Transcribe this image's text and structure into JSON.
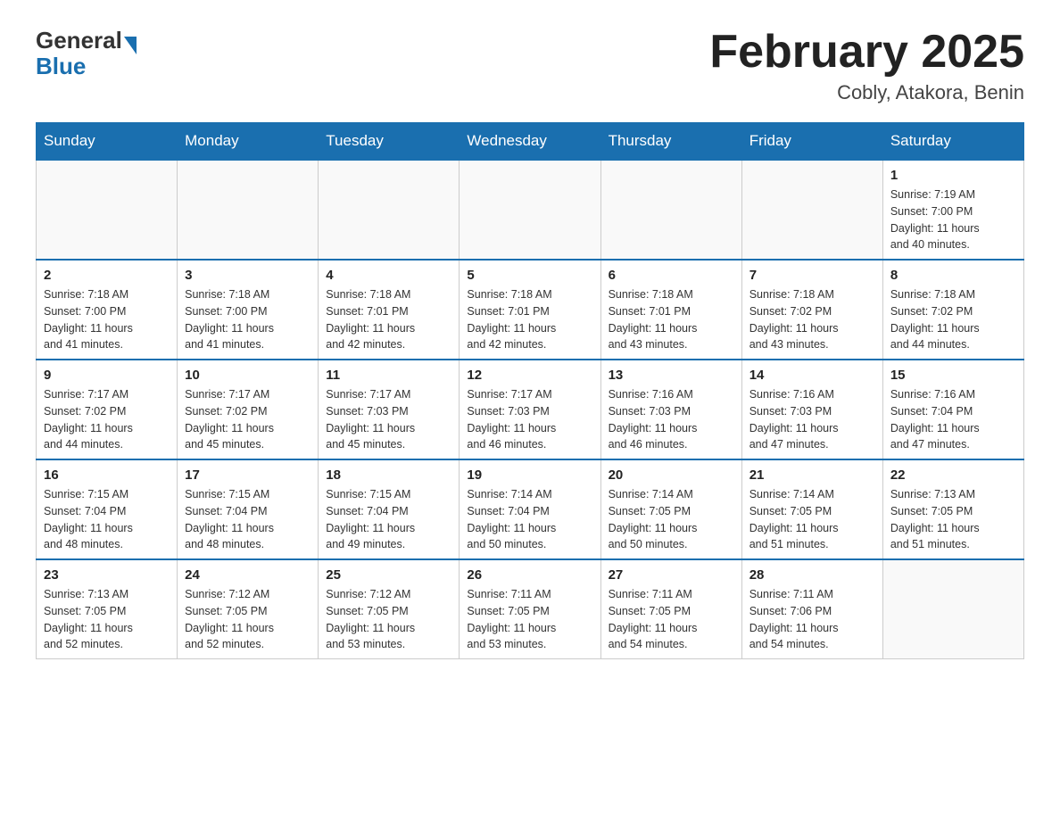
{
  "header": {
    "logo": {
      "general": "General",
      "blue": "Blue"
    },
    "title": "February 2025",
    "location": "Cobly, Atakora, Benin"
  },
  "days_of_week": [
    "Sunday",
    "Monday",
    "Tuesday",
    "Wednesday",
    "Thursday",
    "Friday",
    "Saturday"
  ],
  "weeks": [
    [
      {
        "day": "",
        "info": ""
      },
      {
        "day": "",
        "info": ""
      },
      {
        "day": "",
        "info": ""
      },
      {
        "day": "",
        "info": ""
      },
      {
        "day": "",
        "info": ""
      },
      {
        "day": "",
        "info": ""
      },
      {
        "day": "1",
        "info": "Sunrise: 7:19 AM\nSunset: 7:00 PM\nDaylight: 11 hours\nand 40 minutes."
      }
    ],
    [
      {
        "day": "2",
        "info": "Sunrise: 7:18 AM\nSunset: 7:00 PM\nDaylight: 11 hours\nand 41 minutes."
      },
      {
        "day": "3",
        "info": "Sunrise: 7:18 AM\nSunset: 7:00 PM\nDaylight: 11 hours\nand 41 minutes."
      },
      {
        "day": "4",
        "info": "Sunrise: 7:18 AM\nSunset: 7:01 PM\nDaylight: 11 hours\nand 42 minutes."
      },
      {
        "day": "5",
        "info": "Sunrise: 7:18 AM\nSunset: 7:01 PM\nDaylight: 11 hours\nand 42 minutes."
      },
      {
        "day": "6",
        "info": "Sunrise: 7:18 AM\nSunset: 7:01 PM\nDaylight: 11 hours\nand 43 minutes."
      },
      {
        "day": "7",
        "info": "Sunrise: 7:18 AM\nSunset: 7:02 PM\nDaylight: 11 hours\nand 43 minutes."
      },
      {
        "day": "8",
        "info": "Sunrise: 7:18 AM\nSunset: 7:02 PM\nDaylight: 11 hours\nand 44 minutes."
      }
    ],
    [
      {
        "day": "9",
        "info": "Sunrise: 7:17 AM\nSunset: 7:02 PM\nDaylight: 11 hours\nand 44 minutes."
      },
      {
        "day": "10",
        "info": "Sunrise: 7:17 AM\nSunset: 7:02 PM\nDaylight: 11 hours\nand 45 minutes."
      },
      {
        "day": "11",
        "info": "Sunrise: 7:17 AM\nSunset: 7:03 PM\nDaylight: 11 hours\nand 45 minutes."
      },
      {
        "day": "12",
        "info": "Sunrise: 7:17 AM\nSunset: 7:03 PM\nDaylight: 11 hours\nand 46 minutes."
      },
      {
        "day": "13",
        "info": "Sunrise: 7:16 AM\nSunset: 7:03 PM\nDaylight: 11 hours\nand 46 minutes."
      },
      {
        "day": "14",
        "info": "Sunrise: 7:16 AM\nSunset: 7:03 PM\nDaylight: 11 hours\nand 47 minutes."
      },
      {
        "day": "15",
        "info": "Sunrise: 7:16 AM\nSunset: 7:04 PM\nDaylight: 11 hours\nand 47 minutes."
      }
    ],
    [
      {
        "day": "16",
        "info": "Sunrise: 7:15 AM\nSunset: 7:04 PM\nDaylight: 11 hours\nand 48 minutes."
      },
      {
        "day": "17",
        "info": "Sunrise: 7:15 AM\nSunset: 7:04 PM\nDaylight: 11 hours\nand 48 minutes."
      },
      {
        "day": "18",
        "info": "Sunrise: 7:15 AM\nSunset: 7:04 PM\nDaylight: 11 hours\nand 49 minutes."
      },
      {
        "day": "19",
        "info": "Sunrise: 7:14 AM\nSunset: 7:04 PM\nDaylight: 11 hours\nand 50 minutes."
      },
      {
        "day": "20",
        "info": "Sunrise: 7:14 AM\nSunset: 7:05 PM\nDaylight: 11 hours\nand 50 minutes."
      },
      {
        "day": "21",
        "info": "Sunrise: 7:14 AM\nSunset: 7:05 PM\nDaylight: 11 hours\nand 51 minutes."
      },
      {
        "day": "22",
        "info": "Sunrise: 7:13 AM\nSunset: 7:05 PM\nDaylight: 11 hours\nand 51 minutes."
      }
    ],
    [
      {
        "day": "23",
        "info": "Sunrise: 7:13 AM\nSunset: 7:05 PM\nDaylight: 11 hours\nand 52 minutes."
      },
      {
        "day": "24",
        "info": "Sunrise: 7:12 AM\nSunset: 7:05 PM\nDaylight: 11 hours\nand 52 minutes."
      },
      {
        "day": "25",
        "info": "Sunrise: 7:12 AM\nSunset: 7:05 PM\nDaylight: 11 hours\nand 53 minutes."
      },
      {
        "day": "26",
        "info": "Sunrise: 7:11 AM\nSunset: 7:05 PM\nDaylight: 11 hours\nand 53 minutes."
      },
      {
        "day": "27",
        "info": "Sunrise: 7:11 AM\nSunset: 7:05 PM\nDaylight: 11 hours\nand 54 minutes."
      },
      {
        "day": "28",
        "info": "Sunrise: 7:11 AM\nSunset: 7:06 PM\nDaylight: 11 hours\nand 54 minutes."
      },
      {
        "day": "",
        "info": ""
      }
    ]
  ]
}
